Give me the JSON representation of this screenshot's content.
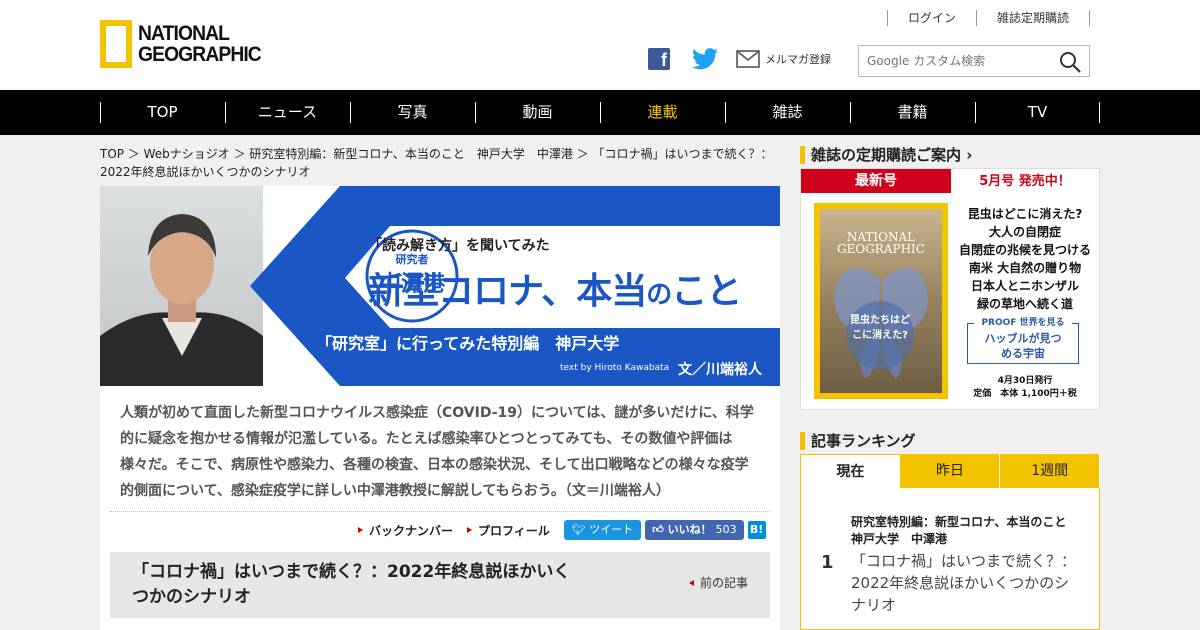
{
  "header": {
    "logo_line1": "NATIONAL",
    "logo_line2": "GEOGRAPHIC",
    "login": "ログイン",
    "subscribe": "雑誌定期購読",
    "fb_glyph": "f",
    "newsletter": "メルマガ登録",
    "search_placeholder": "Google カスタム検索"
  },
  "nav": [
    "TOP",
    "ニュース",
    "写真",
    "動画",
    "連載",
    "雑誌",
    "書籍",
    "TV"
  ],
  "nav_active_index": 4,
  "breadcrumb": "TOP ＞ Webナショジオ ＞ 研究室特別編：新型コロナ、本当のこと　神戸大学　中澤港 ＞ 「コロナ禍」はいつまで続く？：2022年終息説ほかいくつかのシナリオ",
  "hero": {
    "researcher_label": "研究者",
    "researcher_name": "中澤港",
    "subtitle": "「読み解き方」を聞いてみた",
    "title_a": "新型コロナ、本当",
    "title_b": "の",
    "title_c": "こと",
    "special": "「研究室」に行ってみた特別編　神戸大学",
    "credit_en": "text by Hiroto Kawabata",
    "credit_ja": "文／川端裕人"
  },
  "intro": "人類が初めて直面した新型コロナウイルス感染症（COVID-19）については、謎が多いだけに、科学的に疑念を抱かせる情報が氾濫している。たとえば感染率ひとつとってみても、その数値や評価は様々だ。そこで、病原性や感染力、各種の検査、日本の感染状況、そして出口戦略などの様々な疫学的側面について、感染症疫学に詳しい中澤港教授に解説してもらおう。（文＝川端裕人）",
  "article_links": {
    "back_numbers": "バックナンバー",
    "profile": "プロフィール",
    "tweet": "ツイート",
    "like": "いいね！",
    "like_count": "503",
    "hatena": "B!"
  },
  "article_title": "「コロナ禍」はいつまで続く？：2022年終息説ほかいくつかのシナリオ",
  "prev_article": "前の記事",
  "sidebar": {
    "subscription_heading": "雑誌の定期購読ご案内",
    "latest": "最新号",
    "on_sale": "5月号 発売中！",
    "cover_ng_line1": "NATIONAL",
    "cover_ng_line2": "GEOGRAPHIC",
    "cover_text": "昆虫たちはどこに消えた?",
    "headlines": [
      "昆虫はどこに消えた?",
      "大人の自閉症",
      "自閉症の兆候を見つける",
      "南米 大自然の贈り物",
      "日本人とニホンザル",
      "緑の草地へ続く道"
    ],
    "proof_label": "PROOF 世界を見る",
    "proof_text": "ハッブルが見つめる宇宙",
    "pub_date": "4月30日発行",
    "price": "定価　本体 1,100円＋税",
    "ranking_heading": "記事ランキング",
    "tabs": [
      "現在",
      "昨日",
      "1週間"
    ],
    "rank_number": "1",
    "rank_category": "研究室特別編：新型コロナ、本当のこと　神戸大学　中澤港",
    "rank_title": "「コロナ禍」はいつまで続く？：2022年終息説ほかいくつかのシナリオ"
  },
  "colors": {
    "brand_yellow": "#f3c300",
    "nav_bg": "#000000",
    "hero_blue": "#1a56c4",
    "accent_red": "#d0021b"
  }
}
